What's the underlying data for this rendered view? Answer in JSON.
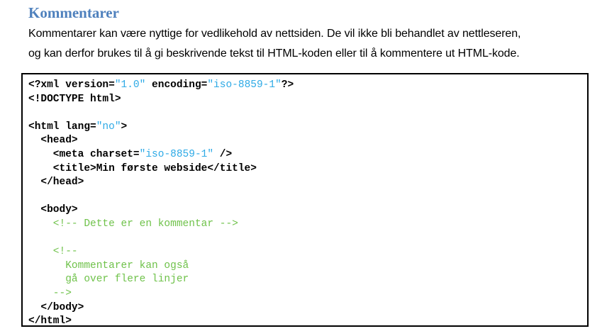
{
  "heading": "Kommentarer",
  "intro": {
    "line1": "Kommentarer kan være nyttige for vedlikehold av nettsiden. De vil ikke bli behandlet av nettleseren,",
    "line2": "og kan derfor brukes til å gi beskrivende tekst til HTML-koden eller til å kommentere ut HTML-kode."
  },
  "colors": {
    "heading": "#4f81bd",
    "string": "#2eaae6",
    "comment": "#6fc24a",
    "tag": "#000000"
  },
  "code": {
    "l1": {
      "a": "<?xml version=",
      "b": "\"1.0\"",
      "c": " encoding=",
      "d": "\"iso-8859-1\"",
      "e": "?>"
    },
    "l2": "<!DOCTYPE html>",
    "l4": {
      "a": "<html lang=",
      "b": "\"no\"",
      "c": ">"
    },
    "l5": "  <head>",
    "l6": {
      "a": "    <meta charset=",
      "b": "\"iso-8859-1\"",
      "c": " />"
    },
    "l7": "    <title>Min første webside</title>",
    "l8": "  </head>",
    "l10": "  <body>",
    "l11": "    <!-- Dette er en kommentar -->",
    "l13": "    <!--",
    "l14": "      Kommentarer kan også",
    "l15": "      gå over flere linjer",
    "l16": "    -->",
    "l17": "  </body>",
    "l18": "</html>"
  }
}
